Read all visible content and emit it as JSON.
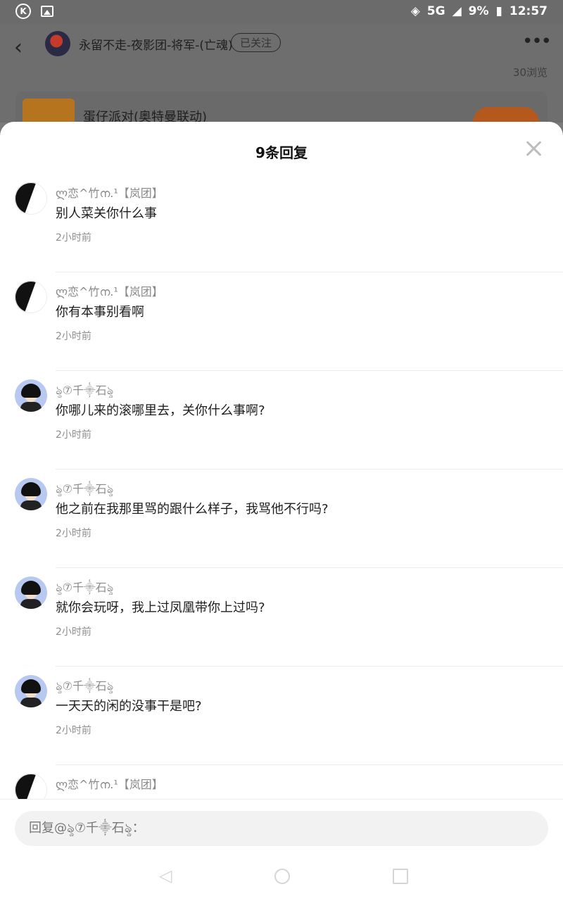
{
  "status_bar": {
    "network": "5G",
    "battery": "9%",
    "time": "12:57"
  },
  "header": {
    "title": "永留不走-夜影团-将军-(亡魂)",
    "follow_label": "已关注",
    "views": "30浏览",
    "more_icon": "ellipsis-icon"
  },
  "game_card": {
    "title": "蛋仔派对(奥特曼联动)"
  },
  "sheet": {
    "title": "9条回复"
  },
  "replies": [
    {
      "user": "ლ恋^竹ന.¹【岚团】",
      "text": "别人菜关你什么事",
      "time": "2小时前",
      "avatar": "moon"
    },
    {
      "user": "ლ恋^竹ന.¹【岚团】",
      "text": "你有本事别看啊",
      "time": "2小时前",
      "avatar": "moon"
    },
    {
      "user": "ৡ⑦千⸎石ৡ",
      "text": "你哪儿来的滚哪里去，关你什么事啊?",
      "time": "2小时前",
      "avatar": "anime"
    },
    {
      "user": "ৡ⑦千⸎石ৡ",
      "text": "他之前在我那里骂的跟什么样子，我骂他不行吗?",
      "time": "2小时前",
      "avatar": "anime"
    },
    {
      "user": "ৡ⑦千⸎石ৡ",
      "text": "就你会玩呀，我上过凤凰带你上过吗?",
      "time": "2小时前",
      "avatar": "anime"
    },
    {
      "user": "ৡ⑦千⸎石ৡ",
      "text": "一天天的闲的没事干是吧?",
      "time": "2小时前",
      "avatar": "anime"
    },
    {
      "user": "ლ恋^竹ന.¹【岚团】",
      "text": "",
      "time": "",
      "avatar": "moon"
    }
  ],
  "reply_input": {
    "placeholder": "回复@ৡ⑦千⸎石ৡ："
  }
}
